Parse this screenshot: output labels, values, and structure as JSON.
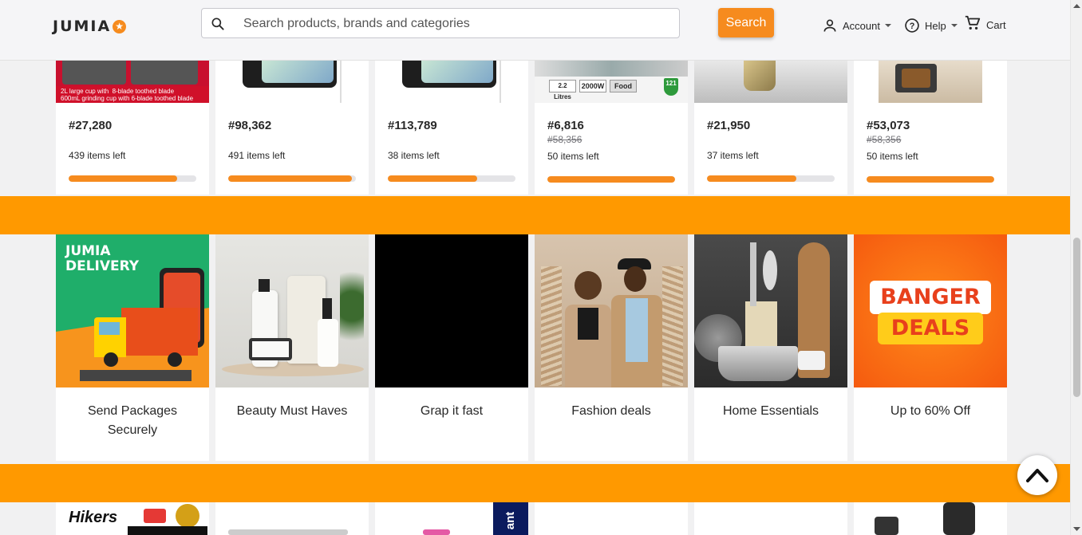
{
  "header": {
    "logo_text": "JUMIA",
    "search_placeholder": "Search products, brands and categories",
    "search_button": "Search",
    "account": "Account",
    "help": "Help",
    "cart": "Cart"
  },
  "products": [
    {
      "price": "#27,280",
      "old_price": "",
      "items_left": "439 items left",
      "progress": 0.85,
      "img_caption": "2L large cup with  8-blade toothed blade\n600mL grinding cup with 6-blade toothed blade"
    },
    {
      "price": "#98,362",
      "old_price": "",
      "items_left": "491 items left",
      "progress": 0.97
    },
    {
      "price": "#113,789",
      "old_price": "",
      "items_left": "38 items left",
      "progress": 0.7
    },
    {
      "price": "#6,816",
      "old_price": "#58,356",
      "items_left": "50 items left",
      "progress": 1.0,
      "img_badges": [
        "2.2 Litres",
        "2000W",
        "Food",
        "121"
      ]
    },
    {
      "price": "#21,950",
      "old_price": "",
      "items_left": "37 items left",
      "progress": 0.7
    },
    {
      "price": "#53,073",
      "old_price": "#58,356",
      "items_left": "50 items left",
      "progress": 1.0
    }
  ],
  "categories": [
    {
      "title": "Send Packages Securely",
      "img_text": "JUMIA DELIVERY"
    },
    {
      "title": "Beauty Must Haves"
    },
    {
      "title": "Grap it fast"
    },
    {
      "title": "Fashion deals"
    },
    {
      "title": "Home Essentials"
    },
    {
      "title": "Up to 60% Off",
      "img_text_1": "BANGER",
      "img_text_2": "DEALS"
    }
  ],
  "bottom_row": {
    "card1_text": "Hikers",
    "card3_text": "ant"
  },
  "colors": {
    "accent": "#f68b1e",
    "band": "#ff9900",
    "text": "#282828"
  }
}
